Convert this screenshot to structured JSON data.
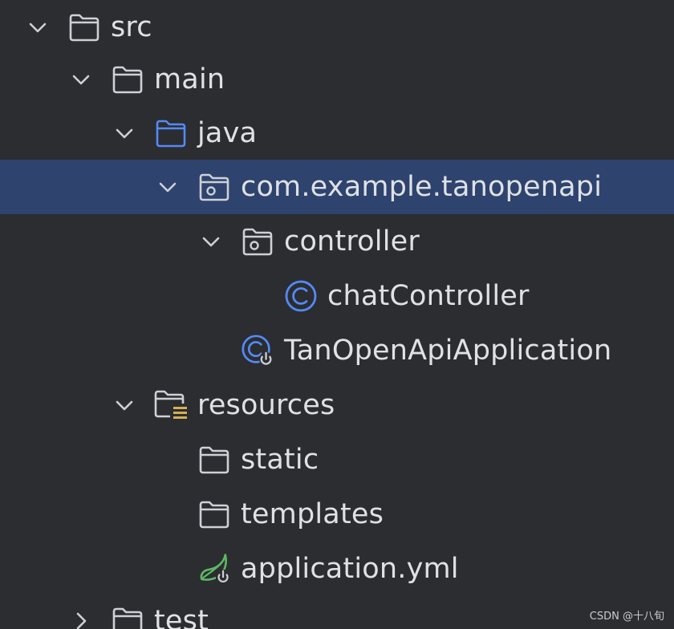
{
  "tree": {
    "items": [
      {
        "label": "src",
        "depth": 0,
        "expanded": true,
        "icon": "folder-icon"
      },
      {
        "label": "main",
        "depth": 1,
        "expanded": true,
        "icon": "folder-icon"
      },
      {
        "label": "java",
        "depth": 2,
        "expanded": true,
        "icon": "source-folder-icon"
      },
      {
        "label": "com.example.tanopenapi",
        "depth": 3,
        "expanded": true,
        "icon": "package-icon",
        "selected": true
      },
      {
        "label": "controller",
        "depth": 4,
        "expanded": true,
        "icon": "package-icon"
      },
      {
        "label": "chatController",
        "depth": 5,
        "icon": "java-class-icon"
      },
      {
        "label": "TanOpenApiApplication",
        "depth": 4,
        "icon": "spring-boot-app-icon"
      },
      {
        "label": "resources",
        "depth": 2,
        "expanded": true,
        "icon": "resources-folder-icon"
      },
      {
        "label": "static",
        "depth": 3,
        "icon": "folder-icon"
      },
      {
        "label": "templates",
        "depth": 3,
        "icon": "folder-icon"
      },
      {
        "label": "application.yml",
        "depth": 3,
        "icon": "spring-config-icon"
      },
      {
        "label": "test",
        "depth": 1,
        "expanded": false,
        "icon": "folder-icon"
      }
    ]
  },
  "watermark": "CSDN @十八旬",
  "colors": {
    "background": "#2b2d30",
    "selection": "#2e436e",
    "text": "#dfe1e5",
    "icon_gray": "#ced0d6",
    "icon_blue": "#548af7",
    "icon_yellow": "#d6ae58",
    "icon_green": "#5fb865"
  }
}
